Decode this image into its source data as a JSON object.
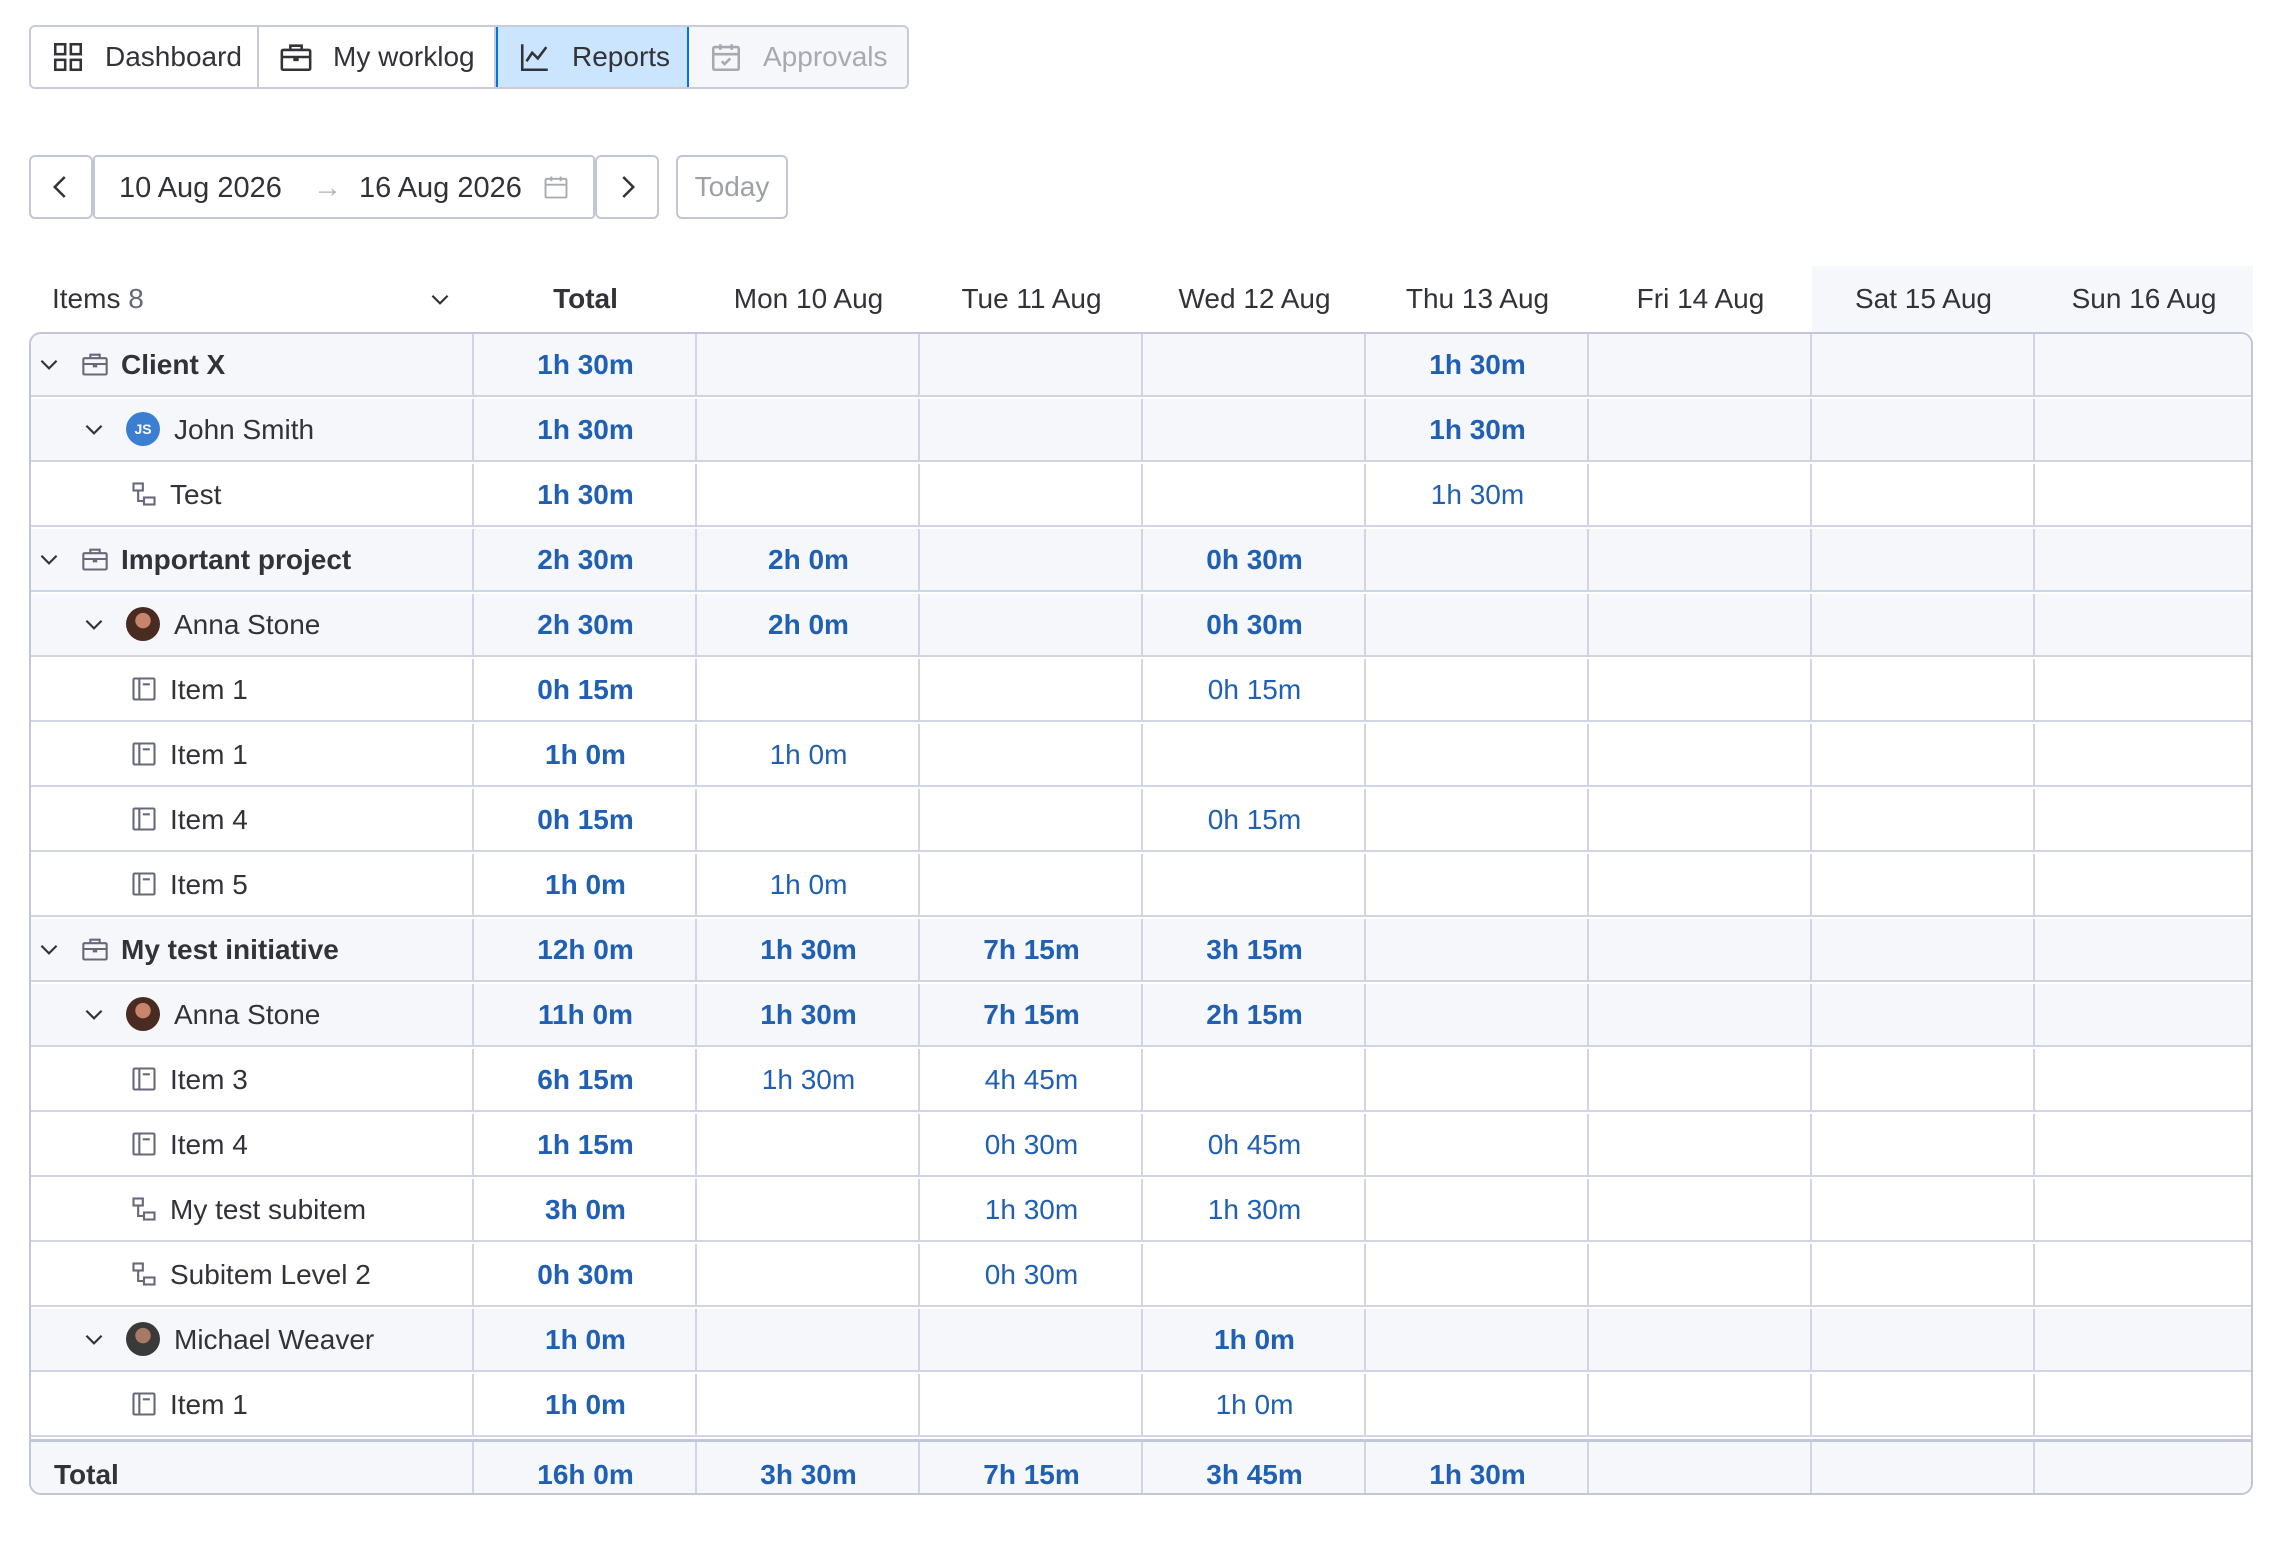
{
  "tabs": [
    {
      "label": "Dashboard",
      "icon": "grid-icon",
      "state": "normal"
    },
    {
      "label": "My worklog",
      "icon": "briefcase-icon",
      "state": "normal"
    },
    {
      "label": "Reports",
      "icon": "chart-line-icon",
      "state": "active"
    },
    {
      "label": "Approvals",
      "icon": "calendar-check-icon",
      "state": "disabled"
    }
  ],
  "date_range": {
    "start": "10 Aug 2026",
    "end": "16 Aug 2026",
    "separator": "→",
    "today_label": "Today"
  },
  "table": {
    "items_label": "Items",
    "items_count": "8",
    "columns": [
      "Total",
      "Mon 10 Aug",
      "Tue 11 Aug",
      "Wed 12 Aug",
      "Thu 13 Aug",
      "Fri 14 Aug",
      "Sat 15 Aug",
      "Sun 16 Aug"
    ],
    "rows": [
      {
        "label": "Client X",
        "level": 0,
        "kind": "group",
        "values": [
          "1h 30m",
          "",
          "",
          "",
          "1h 30m",
          "",
          "",
          ""
        ]
      },
      {
        "label": "John Smith",
        "level": 1,
        "kind": "person",
        "avatar": "JS",
        "values": [
          "1h 30m",
          "",
          "",
          "",
          "1h 30m",
          "",
          "",
          ""
        ]
      },
      {
        "label": "Test",
        "level": 2,
        "kind": "subitem",
        "values": [
          "1h 30m",
          "",
          "",
          "",
          "1h 30m",
          "",
          "",
          ""
        ]
      },
      {
        "label": "Important project",
        "level": 0,
        "kind": "group",
        "values": [
          "2h 30m",
          "2h 0m",
          "",
          "0h 30m",
          "",
          "",
          "",
          ""
        ]
      },
      {
        "label": "Anna Stone",
        "level": 1,
        "kind": "person",
        "avatar": "",
        "values": [
          "2h 30m",
          "2h 0m",
          "",
          "0h 30m",
          "",
          "",
          "",
          ""
        ]
      },
      {
        "label": "Item 1",
        "level": 2,
        "kind": "item",
        "values": [
          "0h 15m",
          "",
          "",
          "0h 15m",
          "",
          "",
          "",
          ""
        ]
      },
      {
        "label": "Item 1",
        "level": 2,
        "kind": "item",
        "values": [
          "1h 0m",
          "1h 0m",
          "",
          "",
          "",
          "",
          "",
          ""
        ]
      },
      {
        "label": "Item 4",
        "level": 2,
        "kind": "item",
        "values": [
          "0h 15m",
          "",
          "",
          "0h 15m",
          "",
          "",
          "",
          ""
        ]
      },
      {
        "label": "Item 5",
        "level": 2,
        "kind": "item",
        "values": [
          "1h 0m",
          "1h 0m",
          "",
          "",
          "",
          "",
          "",
          ""
        ]
      },
      {
        "label": "My test initiative",
        "level": 0,
        "kind": "group",
        "values": [
          "12h 0m",
          "1h 30m",
          "7h 15m",
          "3h 15m",
          "",
          "",
          "",
          ""
        ]
      },
      {
        "label": "Anna Stone",
        "level": 1,
        "kind": "person",
        "avatar": "",
        "values": [
          "11h 0m",
          "1h 30m",
          "7h 15m",
          "2h 15m",
          "",
          "",
          "",
          ""
        ]
      },
      {
        "label": "Item 3",
        "level": 2,
        "kind": "item",
        "values": [
          "6h 15m",
          "1h 30m",
          "4h 45m",
          "",
          "",
          "",
          "",
          ""
        ]
      },
      {
        "label": "Item 4",
        "level": 2,
        "kind": "item",
        "values": [
          "1h 15m",
          "",
          "0h 30m",
          "0h 45m",
          "",
          "",
          "",
          ""
        ]
      },
      {
        "label": "My test subitem",
        "level": 2,
        "kind": "subitem",
        "values": [
          "3h 0m",
          "",
          "1h 30m",
          "1h 30m",
          "",
          "",
          "",
          ""
        ]
      },
      {
        "label": "Subitem Level 2",
        "level": 2,
        "kind": "subitem",
        "values": [
          "0h 30m",
          "",
          "0h 30m",
          "",
          "",
          "",
          "",
          ""
        ]
      },
      {
        "label": "Michael Weaver",
        "level": 1,
        "kind": "person",
        "avatar": "",
        "values": [
          "1h 0m",
          "",
          "",
          "1h 0m",
          "",
          "",
          "",
          ""
        ]
      },
      {
        "label": "Item 1",
        "level": 2,
        "kind": "item",
        "values": [
          "1h 0m",
          "",
          "",
          "1h 0m",
          "",
          "",
          "",
          ""
        ]
      }
    ],
    "total": {
      "label": "Total",
      "values": [
        "16h 0m",
        "3h 30m",
        "7h 15m",
        "3h 45m",
        "1h 30m",
        "",
        "",
        ""
      ]
    }
  },
  "colors": {
    "accent": "#0073ea",
    "value_text": "#1f5fb4",
    "active_tab_bg": "#cce5ff"
  }
}
